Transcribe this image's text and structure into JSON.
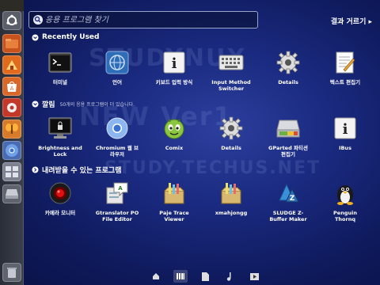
{
  "search": {
    "placeholder": "응용 프로그램 찾기"
  },
  "filter_label": "결과 거르기 ▸",
  "sections": {
    "recent": {
      "title": "Recently Used"
    },
    "installed": {
      "title": "깔림",
      "subtitle": "50개의 응용 프로그램이 더 있습니다."
    },
    "downloadable": {
      "title": "내려받을 수 있는 프로그램"
    }
  },
  "recent_apps": [
    {
      "label": "터미널",
      "icon": "terminal-icon"
    },
    {
      "label": "언어",
      "icon": "language-icon"
    },
    {
      "label": "키보드 입력 방식",
      "icon": "info-icon"
    },
    {
      "label": "Input Method\nSwitcher",
      "icon": "keyboard-icon"
    },
    {
      "label": "Details",
      "icon": "gear-icon"
    },
    {
      "label": "텍스트 편집기",
      "icon": "text-editor-icon"
    }
  ],
  "installed_apps": [
    {
      "label": "Brightness and\nLock",
      "icon": "monitor-lock-icon"
    },
    {
      "label": "Chromium 웹 브\n라우저",
      "icon": "chromium-icon"
    },
    {
      "label": "Comix",
      "icon": "comix-icon"
    },
    {
      "label": "Details",
      "icon": "gear-icon"
    },
    {
      "label": "GParted 파티션\n편집기",
      "icon": "gparted-icon"
    },
    {
      "label": "IBus",
      "icon": "info-icon"
    }
  ],
  "download_apps": [
    {
      "label": "카메라 모니터",
      "icon": "camera-monitor-icon"
    },
    {
      "label": "Gtranslator PO\nFile Editor",
      "icon": "gtranslator-icon"
    },
    {
      "label": "Paje Trace\nViewer",
      "icon": "paje-icon"
    },
    {
      "label": "xmahjongg",
      "icon": "xmahjongg-icon"
    },
    {
      "label": "SLUDGE Z-\nBuffer Maker",
      "icon": "sludge-icon"
    },
    {
      "label": "Penguin\nThornq",
      "icon": "penguin-icon"
    }
  ],
  "watermark": {
    "line1": "STUDYNUX",
    "line2": "NEW Ver1",
    "line3": "STUDY.TECHUS.NET"
  },
  "dock": [
    "home-lens-icon",
    "applications-lens-icon",
    "files-lens-icon",
    "music-lens-icon",
    "video-lens-icon"
  ]
}
